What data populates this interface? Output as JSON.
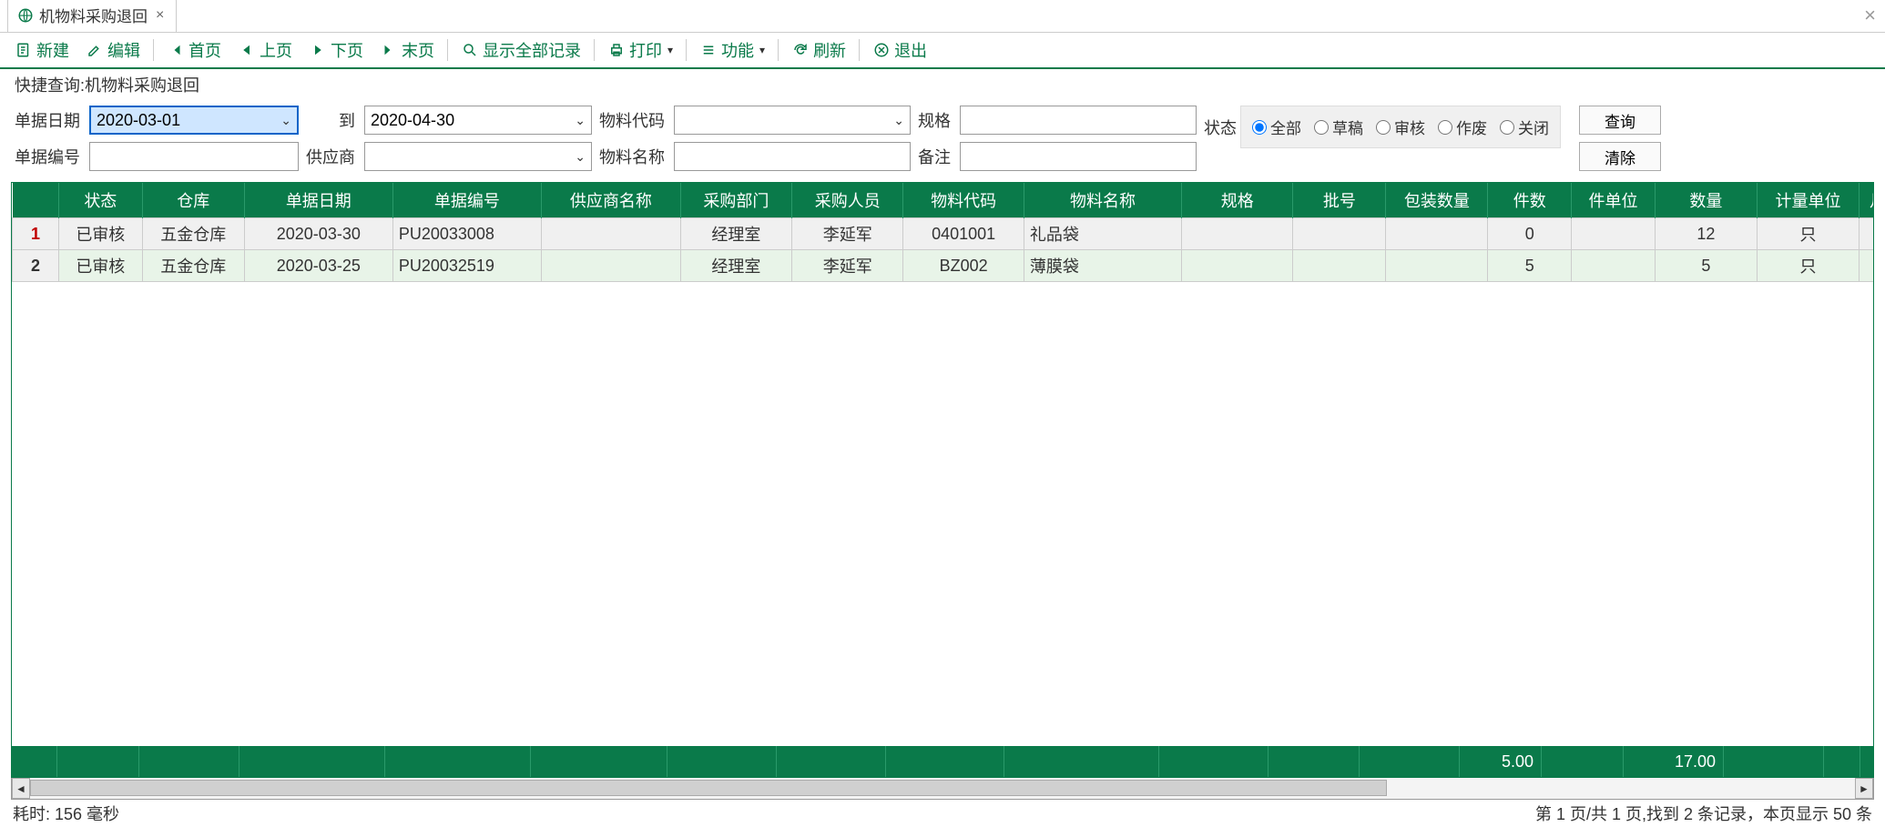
{
  "tab": {
    "title": "机物料采购退回"
  },
  "toolbar": {
    "new": "新建",
    "edit": "编辑",
    "first": "首页",
    "prev": "上页",
    "next": "下页",
    "last": "末页",
    "showAll": "显示全部记录",
    "print": "打印",
    "func": "功能",
    "refresh": "刷新",
    "exit": "退出"
  },
  "panelTitle": "快捷查询:机物料采购退回",
  "labels": {
    "docDate": "单据日期",
    "to": "到",
    "matCode": "物料代码",
    "spec": "规格",
    "docNo": "单据编号",
    "supplier": "供应商",
    "matName": "物料名称",
    "remark": "备注",
    "status": "状态"
  },
  "form": {
    "dateStart": "2020-03-01",
    "dateEnd": "2020-04-30",
    "matCode": "",
    "spec": "",
    "docNo": "",
    "supplier": "",
    "matName": "",
    "remark": ""
  },
  "statusOptions": {
    "all": "全部",
    "draft": "草稿",
    "audit": "审核",
    "void": "作废",
    "close": "关闭"
  },
  "buttons": {
    "query": "查询",
    "clear": "清除"
  },
  "columns": [
    "",
    "状态",
    "仓库",
    "单据日期",
    "单据编号",
    "供应商名称",
    "采购部门",
    "采购人员",
    "物料代码",
    "物料名称",
    "规格",
    "批号",
    "包装数量",
    "件数",
    "件单位",
    "数量",
    "计量单位",
    "月"
  ],
  "rows": [
    {
      "n": "1",
      "status": "已审核",
      "wh": "五金仓库",
      "date": "2020-03-30",
      "no": "PU20033008",
      "supplier": "",
      "dept": "经理室",
      "person": "李延军",
      "code": "0401001",
      "name": "礼品袋",
      "spec": "",
      "batch": "",
      "pack": "",
      "pcs": "0",
      "pcsU": "",
      "qty": "12",
      "unit": "只"
    },
    {
      "n": "2",
      "status": "已审核",
      "wh": "五金仓库",
      "date": "2020-03-25",
      "no": "PU20032519",
      "supplier": "",
      "dept": "经理室",
      "person": "李延军",
      "code": "BZ002",
      "name": "薄膜袋",
      "spec": "",
      "batch": "",
      "pack": "",
      "pcs": "5",
      "pcsU": "",
      "qty": "5",
      "unit": "只"
    }
  ],
  "totals": {
    "pcs": "5.00",
    "qty": "17.00"
  },
  "statusLeft": "耗时: 156 毫秒",
  "statusRight": "第 1 页/共 1 页,找到 2 条记录，本页显示 50 条"
}
